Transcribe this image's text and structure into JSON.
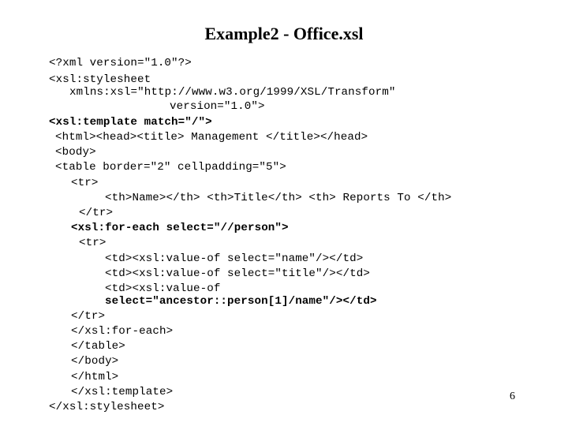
{
  "slide": {
    "title": "Example2 - Office.xsl",
    "page_number": "6"
  },
  "code": {
    "language": "xsl",
    "lines": [
      {
        "text": "<?xml version=\"1.0\"?>",
        "bold": false
      },
      {
        "text": "<xsl:stylesheet",
        "bold": false
      },
      {
        "text": "xmlns:xsl=\"http://www.w3.org/1999/XSL/Transform\"",
        "bold": false
      },
      {
        "text": "version=\"1.0\">",
        "bold": false
      },
      {
        "text": "<xsl:template match=\"/\">",
        "bold": true
      },
      {
        "text": "<html><head><title> Management </title></head>",
        "bold": false
      },
      {
        "text": "<body>",
        "bold": false
      },
      {
        "text": "<table border=\"2\" cellpadding=\"5\">",
        "bold": false
      },
      {
        "text": "<tr>",
        "bold": false
      },
      {
        "text": "<th>Name></th> <th>Title</th> <th> Reports To </th>",
        "bold": false
      },
      {
        "text": "</tr>",
        "bold": false
      },
      {
        "text": "<xsl:for-each select=\"//person\">",
        "bold": true
      },
      {
        "text": "<tr>",
        "bold": false
      },
      {
        "text": "<td><xsl:value-of select=\"name\"/></td>",
        "bold": false
      },
      {
        "text": "<td><xsl:value-of select=\"title\"/></td>",
        "bold": false
      },
      {
        "text": "<td><xsl:value-of",
        "bold": false
      },
      {
        "text": "select=\"ancestor::person[1]/name\"/></td>",
        "bold": true
      },
      {
        "text": "</tr>",
        "bold": false
      },
      {
        "text": "</xsl:for-each>",
        "bold": false
      },
      {
        "text": "</table>",
        "bold": false
      },
      {
        "text": "</body>",
        "bold": false
      },
      {
        "text": "</html>",
        "bold": false
      },
      {
        "text": "</xsl:template>",
        "bold": false
      },
      {
        "text": "</xsl:stylesheet>",
        "bold": false
      }
    ]
  }
}
